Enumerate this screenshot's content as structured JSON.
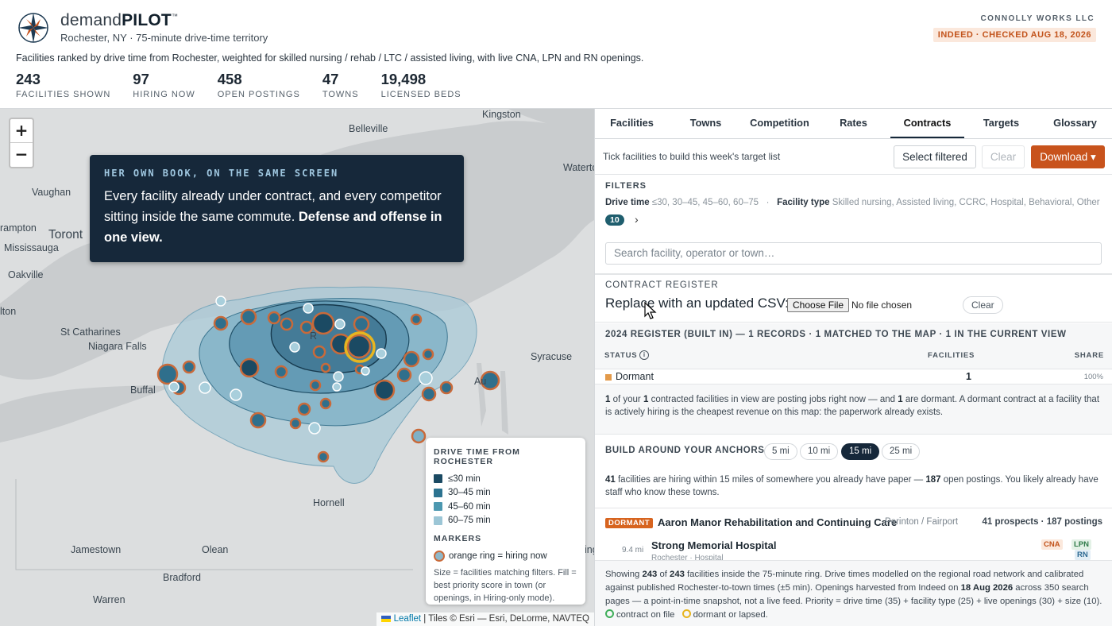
{
  "header": {
    "brand_light": "demand",
    "brand_bold": "PILOT",
    "brand_tm": "™",
    "subtitle": "Rochester, NY · 75-minute drive-time territory",
    "company": "CONNOLLY WORKS LLC",
    "status": "INDEED · CHECKED AUG 18, 2026",
    "description": "Facilities ranked by drive time from Rochester, weighted for skilled nursing / rehab / LTC / assisted living, with live CNA, LPN and RN openings.",
    "stats": [
      {
        "value": "243",
        "label": "FACILITIES SHOWN"
      },
      {
        "value": "97",
        "label": "HIRING NOW"
      },
      {
        "value": "458",
        "label": "OPEN POSTINGS"
      },
      {
        "value": "47",
        "label": "TOWNS"
      },
      {
        "value": "19,498",
        "label": "LICENSED BEDS"
      }
    ]
  },
  "map": {
    "zoom_in": "+",
    "zoom_out": "−",
    "places": {
      "belleville": "Belleville",
      "kingston": "Kingston",
      "watertown": "Waterto",
      "vaughan": "Vaughan",
      "brampton": "rampton",
      "toronto": "Toront",
      "mississauga": "Mississauga",
      "oakville": "Oakville",
      "hamilton": "lton",
      "st_catharines": "St Catharines",
      "niagara_falls": "Niagara Falls",
      "buffalo": "Buffal",
      "syracuse": "Syracuse",
      "auburn": "Au",
      "hornell": "Hornell",
      "jamestown": "Jamestown",
      "olean": "Olean",
      "bradford": "Bradford",
      "warren": "Warren",
      "rochester": "R",
      "binghamton": "ingha"
    },
    "callout": {
      "eyebrow": "HER OWN BOOK, ON THE SAME SCREEN",
      "body": "Every facility already under contract, and every competitor sitting inside the same commute.",
      "body_bold": "Defense and offense in one view."
    },
    "legend": {
      "title": "DRIVE TIME FROM ROCHESTER",
      "bands": [
        {
          "label": "≤30 min",
          "color": "#1b4a63"
        },
        {
          "label": "30–45 min",
          "color": "#2c7390"
        },
        {
          "label": "45–60 min",
          "color": "#4c98b0"
        },
        {
          "label": "60–75 min",
          "color": "#9cc6d6"
        }
      ],
      "markers_title": "MARKERS",
      "ring_label": "orange ring = hiring now",
      "note": "Size = facilities matching filters. Fill = best priority score in town (or openings, in Hiring-only mode)."
    },
    "attribution": {
      "leaflet": "Leaflet",
      "tiles": "| Tiles © Esri — Esri, DeLorme, NAVTEQ"
    }
  },
  "panel": {
    "tabs": [
      {
        "label": "Facilities",
        "active": false
      },
      {
        "label": "Towns",
        "active": false
      },
      {
        "label": "Competition",
        "active": false
      },
      {
        "label": "Rates",
        "active": false
      },
      {
        "label": "Contracts",
        "active": true
      },
      {
        "label": "Targets",
        "active": false
      },
      {
        "label": "Glossary",
        "active": false
      }
    ],
    "toolbar": {
      "hint": "Tick facilities to build this week's target list",
      "select_filtered": "Select filtered",
      "clear": "Clear",
      "download": "Download ▾"
    },
    "filters": {
      "title": "FILTERS",
      "drive_time_label": "Drive time",
      "drive_time_values": "≤30, 30–45, 45–60, 60–75",
      "separator": "·",
      "facility_type_label": "Facility type",
      "facility_type_values": "Skilled nursing, Assisted living, CCRC, Hospital, Behavioral, Other",
      "count": "10",
      "search_placeholder": "Search facility, operator or town…"
    },
    "contract_register": {
      "title": "CONTRACT REGISTER",
      "csv_label": "Replace with an updated CSV:",
      "choose_file": "Choose File",
      "no_file": "No file chosen",
      "clear": "Clear"
    },
    "register": {
      "title": "2024 REGISTER (BUILT IN) — 1 RECORDS · 1 MATCHED TO THE MAP · 1 IN THE CURRENT VIEW",
      "col_status": "STATUS",
      "col_info": "i",
      "col_facilities": "FACILITIES",
      "col_share": "SHARE",
      "rows": [
        {
          "status": "Dormant",
          "facilities": "1",
          "share": "100%",
          "color": "#e39a4a"
        }
      ],
      "note_parts": [
        "1",
        " of your ",
        "1",
        " contracted facilities in view are posting jobs right now — and ",
        "1",
        " are dormant. A dormant contract at a facility that is actively hiring is the cheapest revenue on this map: the paperwork already exists."
      ]
    },
    "anchors": {
      "title": "BUILD AROUND YOUR ANCHORS",
      "chips": [
        {
          "label": "5 mi",
          "active": false
        },
        {
          "label": "10 mi",
          "active": false
        },
        {
          "label": "15 mi",
          "active": true
        },
        {
          "label": "25 mi",
          "active": false
        }
      ],
      "note_parts": [
        "41",
        " facilities are hiring within 15 miles of somewhere you already have paper — ",
        "187",
        " open postings. You likely already have staff who know these towns."
      ]
    },
    "prospect": {
      "tag": "DORMANT",
      "name": "Aaron Manor Rehabilitation and Continuing Care",
      "location": "Perinton / Fairport",
      "summary": "41 prospects · 187 postings",
      "item": {
        "distance": "9.4 mi",
        "name": "Strong Memorial Hospital",
        "sub": "Rochester · Hospital",
        "badges": [
          "CNA",
          "LPN",
          "RN"
        ]
      }
    },
    "footer": {
      "p1": "Showing ",
      "shown": "243",
      "p2": " of ",
      "total": "243",
      "p3": " facilities inside the 75-minute ring. Drive times modelled on the regional road network and calibrated against published Rochester-to-town times (±5 min). Openings harvested from Indeed on ",
      "date": "18 Aug 2026",
      "p4": " across 350 search pages — a point-in-time snapshot, not a live feed. Priority = drive time (35) + facility type (25) + live openings (30) + size (10).",
      "legend_contract": "contract on file",
      "legend_dormant": "dormant or lapsed."
    }
  }
}
